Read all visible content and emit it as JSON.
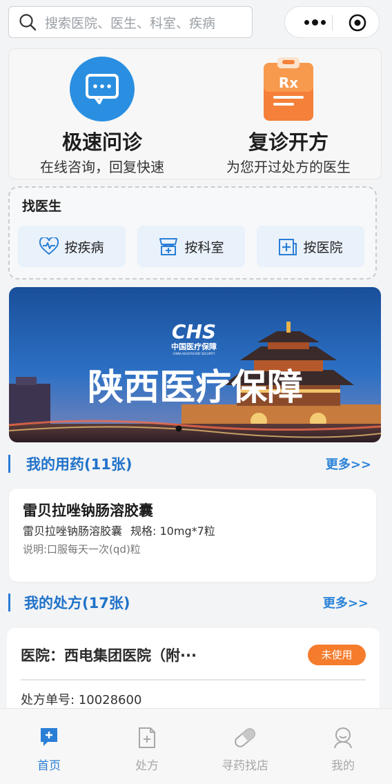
{
  "search": {
    "placeholder": "搜索医院、医生、科室、疾病"
  },
  "quick": [
    {
      "title": "极速问诊",
      "subtitle": "在线咨询，回复快速",
      "icon": "chat-icon"
    },
    {
      "title": "复诊开方",
      "subtitle": "为您开过处方的医生",
      "icon": "rx-clipboard-icon"
    }
  ],
  "find_doctor": {
    "title": "找医生",
    "buttons": [
      {
        "label": "按疾病",
        "icon": "heartbeat-icon"
      },
      {
        "label": "按科室",
        "icon": "department-icon"
      },
      {
        "label": "按医院",
        "icon": "hospital-icon"
      }
    ]
  },
  "banner": {
    "logo_text": "CHS",
    "logo_sub": "中国医疗保障",
    "logo_en": "CHINA HEALTHCARE SECURITY",
    "headline": "陕西医疗保障"
  },
  "medicine": {
    "title": "我的用药(11张)",
    "more": "更多>>",
    "item": {
      "name": "雷贝拉唑钠肠溶胶囊",
      "generic": "雷贝拉唑钠肠溶胶囊",
      "spec": "规格:  10mg*7粒",
      "usage": "说明:口服每天一次(qd)粒"
    }
  },
  "prescription": {
    "title": "我的处方(17张)",
    "more": "更多>>",
    "item": {
      "hospital": "医院：西电集团医院（附···",
      "status": "未使用",
      "number": "处方单号: 10028600"
    }
  },
  "tabbar": [
    {
      "label": "首页",
      "icon": "home-plus-icon",
      "active": true
    },
    {
      "label": "处方",
      "icon": "prescription-doc-icon",
      "active": false
    },
    {
      "label": "寻药找店",
      "icon": "pill-icon",
      "active": false
    },
    {
      "label": "我的",
      "icon": "user-icon",
      "active": false
    }
  ],
  "colors": {
    "accent": "#2a7ed6",
    "chat_icon_bg": "#2a8fe0",
    "rx_orange": "#f5803a",
    "badge": "#f57c2c"
  }
}
